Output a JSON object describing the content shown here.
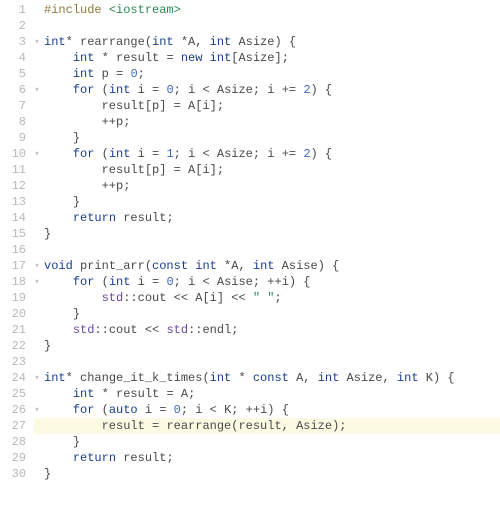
{
  "highlighted_line": 27,
  "lines": [
    {
      "n": 1,
      "fold": "",
      "tokens": [
        [
          "c-pp",
          "#include "
        ],
        [
          "c-inc",
          "<iostream>"
        ]
      ]
    },
    {
      "n": 2,
      "fold": "",
      "tokens": []
    },
    {
      "n": 3,
      "fold": "▸",
      "tokens": [
        [
          "c-kw",
          "int"
        ],
        [
          "c-op",
          "* "
        ],
        [
          "c-id",
          "rearrange"
        ],
        [
          "c-op",
          "("
        ],
        [
          "c-kw",
          "int"
        ],
        [
          "c-op",
          " *"
        ],
        [
          "c-id",
          "A"
        ],
        [
          "c-op",
          ", "
        ],
        [
          "c-kw",
          "int"
        ],
        [
          "c-id",
          " Asize"
        ],
        [
          "c-op",
          ") {"
        ]
      ]
    },
    {
      "n": 4,
      "fold": "",
      "tokens": [
        [
          "",
          null,
          "    "
        ],
        [
          "c-kw",
          "int"
        ],
        [
          "c-op",
          " * "
        ],
        [
          "c-id",
          "result"
        ],
        [
          "c-op",
          " = "
        ],
        [
          "c-kw",
          "new"
        ],
        [
          "c-op",
          " "
        ],
        [
          "c-kw",
          "int"
        ],
        [
          "c-op",
          "["
        ],
        [
          "c-id",
          "Asize"
        ],
        [
          "c-op",
          "];"
        ]
      ]
    },
    {
      "n": 5,
      "fold": "",
      "tokens": [
        [
          "",
          null,
          "    "
        ],
        [
          "c-kw",
          "int"
        ],
        [
          "c-id",
          " p"
        ],
        [
          "c-op",
          " = "
        ],
        [
          "c-num",
          "0"
        ],
        [
          "c-op",
          ";"
        ]
      ]
    },
    {
      "n": 6,
      "fold": "▸",
      "tokens": [
        [
          "",
          null,
          "    "
        ],
        [
          "c-kw",
          "for"
        ],
        [
          "c-op",
          " ("
        ],
        [
          "c-kw",
          "int"
        ],
        [
          "c-id",
          " i"
        ],
        [
          "c-op",
          " = "
        ],
        [
          "c-num",
          "0"
        ],
        [
          "c-op",
          "; "
        ],
        [
          "c-id",
          "i"
        ],
        [
          "c-op",
          " < "
        ],
        [
          "c-id",
          "Asize"
        ],
        [
          "c-op",
          "; "
        ],
        [
          "c-id",
          "i"
        ],
        [
          "c-op",
          " += "
        ],
        [
          "c-num",
          "2"
        ],
        [
          "c-op",
          ") {"
        ]
      ]
    },
    {
      "n": 7,
      "fold": "",
      "tokens": [
        [
          "",
          null,
          "        "
        ],
        [
          "c-id",
          "result"
        ],
        [
          "c-op",
          "["
        ],
        [
          "c-id",
          "p"
        ],
        [
          "c-op",
          "] = "
        ],
        [
          "c-id",
          "A"
        ],
        [
          "c-op",
          "["
        ],
        [
          "c-id",
          "i"
        ],
        [
          "c-op",
          "];"
        ]
      ]
    },
    {
      "n": 8,
      "fold": "",
      "tokens": [
        [
          "",
          null,
          "        ++"
        ],
        [
          "c-id",
          "p"
        ],
        [
          "c-op",
          ";"
        ]
      ]
    },
    {
      "n": 9,
      "fold": "",
      "tokens": [
        [
          "",
          null,
          "    "
        ],
        [
          "c-op",
          "}"
        ]
      ]
    },
    {
      "n": 10,
      "fold": "▸",
      "tokens": [
        [
          "",
          null,
          "    "
        ],
        [
          "c-kw",
          "for"
        ],
        [
          "c-op",
          " ("
        ],
        [
          "c-kw",
          "int"
        ],
        [
          "c-id",
          " i"
        ],
        [
          "c-op",
          " = "
        ],
        [
          "c-num",
          "1"
        ],
        [
          "c-op",
          "; "
        ],
        [
          "c-id",
          "i"
        ],
        [
          "c-op",
          " < "
        ],
        [
          "c-id",
          "Asize"
        ],
        [
          "c-op",
          "; "
        ],
        [
          "c-id",
          "i"
        ],
        [
          "c-op",
          " += "
        ],
        [
          "c-num",
          "2"
        ],
        [
          "c-op",
          ") {"
        ]
      ]
    },
    {
      "n": 11,
      "fold": "",
      "tokens": [
        [
          "",
          null,
          "        "
        ],
        [
          "c-id",
          "result"
        ],
        [
          "c-op",
          "["
        ],
        [
          "c-id",
          "p"
        ],
        [
          "c-op",
          "] = "
        ],
        [
          "c-id",
          "A"
        ],
        [
          "c-op",
          "["
        ],
        [
          "c-id",
          "i"
        ],
        [
          "c-op",
          "];"
        ]
      ]
    },
    {
      "n": 12,
      "fold": "",
      "tokens": [
        [
          "",
          null,
          "        ++"
        ],
        [
          "c-id",
          "p"
        ],
        [
          "c-op",
          ";"
        ]
      ]
    },
    {
      "n": 13,
      "fold": "",
      "tokens": [
        [
          "",
          null,
          "    "
        ],
        [
          "c-op",
          "}"
        ]
      ]
    },
    {
      "n": 14,
      "fold": "",
      "tokens": [
        [
          "",
          null,
          "    "
        ],
        [
          "c-kw",
          "return"
        ],
        [
          "c-id",
          " result"
        ],
        [
          "c-op",
          ";"
        ]
      ]
    },
    {
      "n": 15,
      "fold": "",
      "tokens": [
        [
          "c-op",
          "}"
        ]
      ]
    },
    {
      "n": 16,
      "fold": "",
      "tokens": []
    },
    {
      "n": 17,
      "fold": "▸",
      "tokens": [
        [
          "c-kw",
          "void"
        ],
        [
          "c-id",
          " print_arr"
        ],
        [
          "c-op",
          "("
        ],
        [
          "c-kw",
          "const"
        ],
        [
          "c-op",
          " "
        ],
        [
          "c-kw",
          "int"
        ],
        [
          "c-op",
          " *"
        ],
        [
          "c-id",
          "A"
        ],
        [
          "c-op",
          ", "
        ],
        [
          "c-kw",
          "int"
        ],
        [
          "c-id",
          " Asise"
        ],
        [
          "c-op",
          ") {"
        ]
      ]
    },
    {
      "n": 18,
      "fold": "▸",
      "tokens": [
        [
          "",
          null,
          "    "
        ],
        [
          "c-kw",
          "for"
        ],
        [
          "c-op",
          " ("
        ],
        [
          "c-kw",
          "int"
        ],
        [
          "c-id",
          " i"
        ],
        [
          "c-op",
          " = "
        ],
        [
          "c-num",
          "0"
        ],
        [
          "c-op",
          "; "
        ],
        [
          "c-id",
          "i"
        ],
        [
          "c-op",
          " < "
        ],
        [
          "c-id",
          "Asise"
        ],
        [
          "c-op",
          "; ++"
        ],
        [
          "c-id",
          "i"
        ],
        [
          "c-op",
          ") {"
        ]
      ]
    },
    {
      "n": 19,
      "fold": "",
      "tokens": [
        [
          "",
          null,
          "        "
        ],
        [
          "c-ns",
          "std"
        ],
        [
          "c-op",
          "::"
        ],
        [
          "c-id",
          "cout"
        ],
        [
          "c-op",
          " << "
        ],
        [
          "c-id",
          "A"
        ],
        [
          "c-op",
          "["
        ],
        [
          "c-id",
          "i"
        ],
        [
          "c-op",
          "] << "
        ],
        [
          "c-str",
          "\" \""
        ],
        [
          "c-op",
          ";"
        ]
      ]
    },
    {
      "n": 20,
      "fold": "",
      "tokens": [
        [
          "",
          null,
          "    "
        ],
        [
          "c-op",
          "}"
        ]
      ]
    },
    {
      "n": 21,
      "fold": "",
      "tokens": [
        [
          "",
          null,
          "    "
        ],
        [
          "c-ns",
          "std"
        ],
        [
          "c-op",
          "::"
        ],
        [
          "c-id",
          "cout"
        ],
        [
          "c-op",
          " << "
        ],
        [
          "c-ns",
          "std"
        ],
        [
          "c-op",
          "::"
        ],
        [
          "c-id",
          "endl"
        ],
        [
          "c-op",
          ";"
        ]
      ]
    },
    {
      "n": 22,
      "fold": "",
      "tokens": [
        [
          "c-op",
          "}"
        ]
      ]
    },
    {
      "n": 23,
      "fold": "",
      "tokens": []
    },
    {
      "n": 24,
      "fold": "▸",
      "tokens": [
        [
          "c-kw",
          "int"
        ],
        [
          "c-op",
          "* "
        ],
        [
          "c-id",
          "change_it_k_times"
        ],
        [
          "c-op",
          "("
        ],
        [
          "c-kw",
          "int"
        ],
        [
          "c-op",
          " * "
        ],
        [
          "c-kw",
          "const"
        ],
        [
          "c-id",
          " A"
        ],
        [
          "c-op",
          ", "
        ],
        [
          "c-kw",
          "int"
        ],
        [
          "c-id",
          " Asize"
        ],
        [
          "c-op",
          ", "
        ],
        [
          "c-kw",
          "int"
        ],
        [
          "c-id",
          " K"
        ],
        [
          "c-op",
          ") {"
        ]
      ]
    },
    {
      "n": 25,
      "fold": "",
      "tokens": [
        [
          "",
          null,
          "    "
        ],
        [
          "c-kw",
          "int"
        ],
        [
          "c-op",
          " * "
        ],
        [
          "c-id",
          "result"
        ],
        [
          "c-op",
          " = "
        ],
        [
          "c-id",
          "A"
        ],
        [
          "c-op",
          ";"
        ]
      ]
    },
    {
      "n": 26,
      "fold": "▸",
      "tokens": [
        [
          "",
          null,
          "    "
        ],
        [
          "c-kw",
          "for"
        ],
        [
          "c-op",
          " ("
        ],
        [
          "c-kw",
          "auto"
        ],
        [
          "c-id",
          " i"
        ],
        [
          "c-op",
          " = "
        ],
        [
          "c-num",
          "0"
        ],
        [
          "c-op",
          "; "
        ],
        [
          "c-id",
          "i"
        ],
        [
          "c-op",
          " < "
        ],
        [
          "c-id",
          "K"
        ],
        [
          "c-op",
          "; ++"
        ],
        [
          "c-id",
          "i"
        ],
        [
          "c-op",
          ") {"
        ]
      ]
    },
    {
      "n": 27,
      "fold": "",
      "tokens": [
        [
          "",
          null,
          "        "
        ],
        [
          "c-id",
          "result"
        ],
        [
          "c-op",
          " = "
        ],
        [
          "c-id",
          "rearrange"
        ],
        [
          "c-op",
          "("
        ],
        [
          "c-id",
          "result"
        ],
        [
          "c-op",
          ", "
        ],
        [
          "c-id",
          "Asize"
        ],
        [
          "c-op",
          ");"
        ]
      ]
    },
    {
      "n": 28,
      "fold": "",
      "tokens": [
        [
          "",
          null,
          "    "
        ],
        [
          "c-op",
          "}"
        ]
      ]
    },
    {
      "n": 29,
      "fold": "",
      "tokens": [
        [
          "",
          null,
          "    "
        ],
        [
          "c-kw",
          "return"
        ],
        [
          "c-id",
          " result"
        ],
        [
          "c-op",
          ";"
        ]
      ]
    },
    {
      "n": 30,
      "fold": "",
      "tokens": [
        [
          "c-op",
          "}"
        ]
      ]
    }
  ]
}
